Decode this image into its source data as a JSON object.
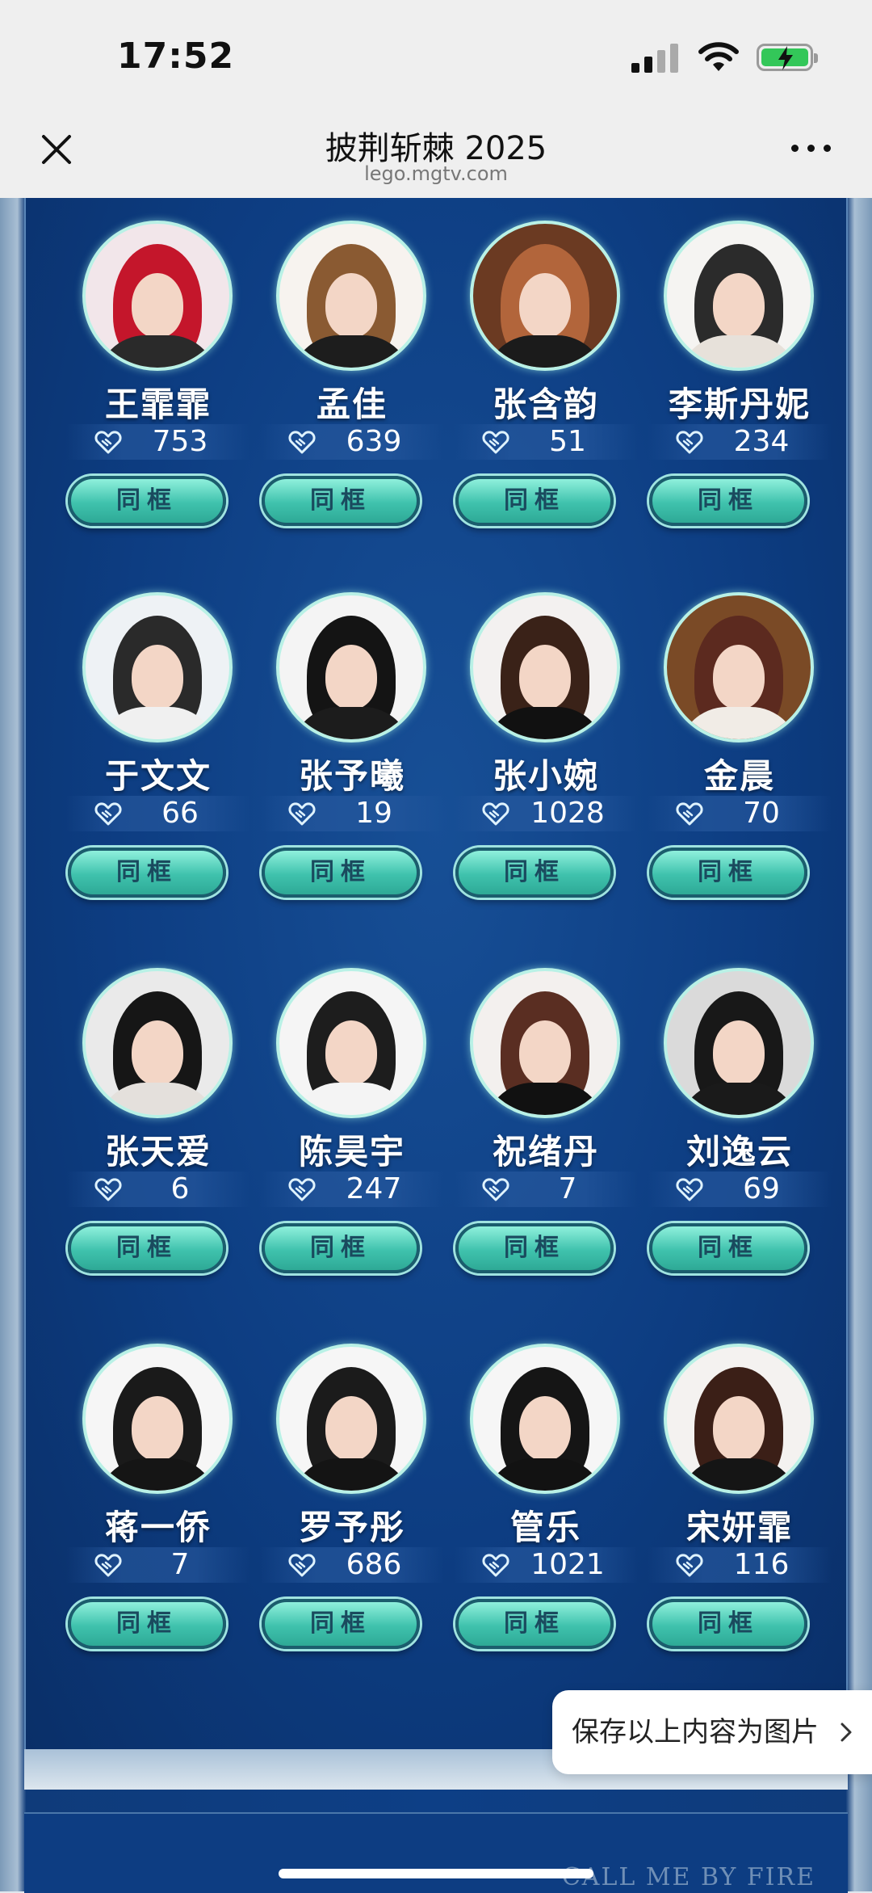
{
  "status_bar": {
    "time": "17:52"
  },
  "header": {
    "title": "披荆斩棘 2025",
    "url": "lego.mgtv.com"
  },
  "contestants": [
    {
      "name": "王霏霏",
      "votes": "753",
      "button": "同框",
      "hair": "#c4162b",
      "body": "#2a2a2a",
      "bg": "#f2e6ea"
    },
    {
      "name": "孟佳",
      "votes": "639",
      "button": "同框",
      "hair": "#8a5a32",
      "body": "#1d1d1d",
      "bg": "#f7f3ef"
    },
    {
      "name": "张含韵",
      "votes": "51",
      "button": "同框",
      "hair": "#b2653b",
      "body": "#1b1b1b",
      "bg": "#6b3a22"
    },
    {
      "name": "李斯丹妮",
      "votes": "234",
      "button": "同框",
      "hair": "#2b2b2b",
      "body": "#e7e1da",
      "bg": "#f5f4f2"
    },
    {
      "name": "于文文",
      "votes": "66",
      "button": "同框",
      "hair": "#2a2a2a",
      "body": "#f0f0f0",
      "bg": "#eef2f5"
    },
    {
      "name": "张予曦",
      "votes": "19",
      "button": "同框",
      "hair": "#141414",
      "body": "#1c1c1c",
      "bg": "#f4f4f4"
    },
    {
      "name": "张小婉",
      "votes": "1028",
      "button": "同框",
      "hair": "#3a2218",
      "body": "#111111",
      "bg": "#f3f1f0"
    },
    {
      "name": "金晨",
      "votes": "70",
      "button": "同框",
      "hair": "#5c2a1f",
      "body": "#f1ece6",
      "bg": "#7a4a26"
    },
    {
      "name": "张天爱",
      "votes": "6",
      "button": "同框",
      "hair": "#161616",
      "body": "#e4e0dc",
      "bg": "#eaeaea"
    },
    {
      "name": "陈昊宇",
      "votes": "247",
      "button": "同框",
      "hair": "#1d1d1d",
      "body": "#f4f4f4",
      "bg": "#f5f5f5"
    },
    {
      "name": "祝绪丹",
      "votes": "7",
      "button": "同框",
      "hair": "#5a2e22",
      "body": "#111111",
      "bg": "#f3f0ee"
    },
    {
      "name": "刘逸云",
      "votes": "69",
      "button": "同框",
      "hair": "#181818",
      "body": "#1a1a1a",
      "bg": "#dadada"
    },
    {
      "name": "蒋一侨",
      "votes": "7",
      "button": "同框",
      "hair": "#1a1a1a",
      "body": "#151515",
      "bg": "#f6f6f6"
    },
    {
      "name": "罗予彤",
      "votes": "686",
      "button": "同框",
      "hair": "#1b1b1b",
      "body": "#141414",
      "bg": "#f6f6f6"
    },
    {
      "name": "管乐",
      "votes": "1021",
      "button": "同框",
      "hair": "#151515",
      "body": "#121212",
      "bg": "#f6f6f6"
    },
    {
      "name": "宋妍霏",
      "votes": "116",
      "button": "同框",
      "hair": "#3b1f17",
      "body": "#151515",
      "bg": "#f4f2f0"
    }
  ],
  "save_action": {
    "label": "保存以上内容为图片"
  },
  "footer_text": "CALL ME BY FIRE",
  "colors": {
    "panel": "#0d3d82",
    "button": "#3fc2ad",
    "avatar_ring": "#b9f1e6"
  }
}
